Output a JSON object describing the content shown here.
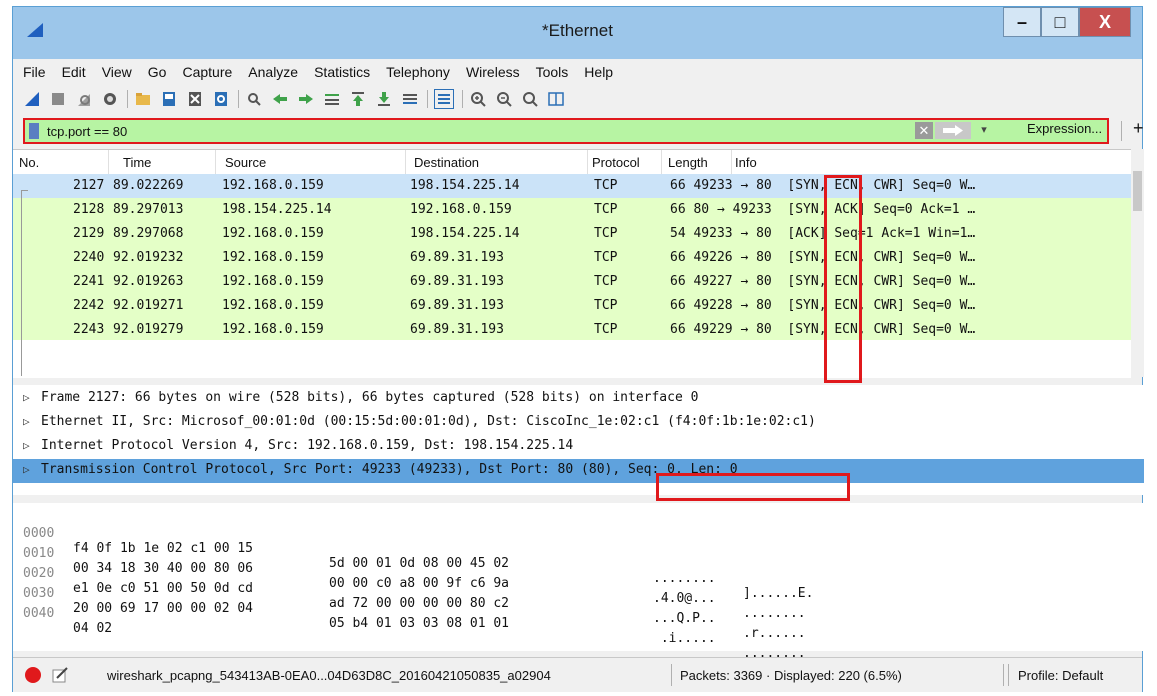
{
  "window": {
    "title": "*Ethernet",
    "min_label": "–",
    "max_label": "□",
    "close_label": "X"
  },
  "menu": [
    "File",
    "Edit",
    "View",
    "Go",
    "Capture",
    "Analyze",
    "Statistics",
    "Telephony",
    "Wireless",
    "Tools",
    "Help"
  ],
  "toolbar_icons": [
    "shark-fin-start",
    "stop",
    "restart",
    "options",
    "open-folder",
    "save",
    "close-file",
    "reload",
    "find",
    "go-back",
    "go-forward",
    "go-to-packet",
    "first-packet",
    "last-packet",
    "autoscroll",
    "colorize",
    "zoom-in",
    "zoom-out",
    "normal-size",
    "resize-columns"
  ],
  "filter": {
    "value": "tcp.port == 80",
    "clear_label": "✕",
    "dropdown_label": "▾",
    "expression_label": "Expression...",
    "plus_label": "+"
  },
  "packet_list": {
    "columns": [
      "No.",
      "Time",
      "Source",
      "Destination",
      "Protocol",
      "Length",
      "Info"
    ],
    "rows": [
      {
        "no": "2127",
        "time": "89.022269",
        "source": "192.168.0.159",
        "destination": "198.154.225.14",
        "protocol": "TCP",
        "info": "66 49233 → 80  [SYN, ECN, CWR] Seq=0 W…"
      },
      {
        "no": "2128",
        "time": "89.297013",
        "source": "198.154.225.14",
        "destination": "192.168.0.159",
        "protocol": "TCP",
        "info": "66 80 → 49233  [SYN, ACK] Seq=0 Ack=1 …"
      },
      {
        "no": "2129",
        "time": "89.297068",
        "source": "192.168.0.159",
        "destination": "198.154.225.14",
        "protocol": "TCP",
        "info": "54 49233 → 80  [ACK] Seq=1 Ack=1 Win=1…"
      },
      {
        "no": "2240",
        "time": "92.019232",
        "source": "192.168.0.159",
        "destination": "69.89.31.193",
        "protocol": "TCP",
        "info": "66 49226 → 80  [SYN, ECN, CWR] Seq=0 W…"
      },
      {
        "no": "2241",
        "time": "92.019263",
        "source": "192.168.0.159",
        "destination": "69.89.31.193",
        "protocol": "TCP",
        "info": "66 49227 → 80  [SYN, ECN, CWR] Seq=0 W…"
      },
      {
        "no": "2242",
        "time": "92.019271",
        "source": "192.168.0.159",
        "destination": "69.89.31.193",
        "protocol": "TCP",
        "info": "66 49228 → 80  [SYN, ECN, CWR] Seq=0 W…"
      },
      {
        "no": "2243",
        "time": "92.019279",
        "source": "192.168.0.159",
        "destination": "69.89.31.193",
        "protocol": "TCP",
        "info": "66 49229 → 80  [SYN, ECN, CWR] Seq=0 W…"
      }
    ]
  },
  "details": [
    {
      "arrow": "▷",
      "text": "Frame 2127: 66 bytes on wire (528 bits), 66 bytes captured (528 bits) on interface 0"
    },
    {
      "arrow": "▷",
      "text": "Ethernet II, Src: Microsof_00:01:0d (00:15:5d:00:01:0d), Dst: CiscoInc_1e:02:c1 (f4:0f:1b:1e:02:c1)"
    },
    {
      "arrow": "▷",
      "text": "Internet Protocol Version 4, Src: 192.168.0.159, Dst: 198.154.225.14"
    },
    {
      "arrow": "▷",
      "text": "Transmission Control Protocol, Src Port: 49233 (49233), Dst Port: 80 (80), Seq: 0, Len: 0"
    }
  ],
  "hex": [
    {
      "offset": "0000",
      "b1": "f4 0f 1b 1e 02 c1 00 15",
      "b2": "5d 00 01 0d 08 00 45 02",
      "a1": "........",
      "a2": "]......E."
    },
    {
      "offset": "0010",
      "b1": "00 34 18 30 40 00 80 06",
      "b2": "00 00 c0 a8 00 9f c6 9a",
      "a1": ".4.0@...",
      "a2": "........"
    },
    {
      "offset": "0020",
      "b1": "e1 0e c0 51 00 50 0d cd",
      "b2": "ad 72 00 00 00 00 80 c2",
      "a1": "...Q.P..",
      "a2": ".r......"
    },
    {
      "offset": "0030",
      "b1": "20 00 69 17 00 00 02 04",
      "b2": "05 b4 01 03 03 08 01 01",
      "a1": " .i.....",
      "a2": "........"
    },
    {
      "offset": "0040",
      "b1": "04 02",
      "b2": "",
      "a1": "..",
      "a2": ""
    }
  ],
  "status": {
    "file": "wireshark_pcapng_543413AB-0EA0...04D63D8C_20160421050835_a02904",
    "packets": "Packets: 3369 · Displayed: 220 (6.5%)",
    "profile": "Profile: Default"
  },
  "colors": {
    "accent": "#e0191c",
    "filter_bg": "#b7f4a3",
    "row_bg": "#e4ffc7",
    "selected_row": "#cbe3f8",
    "selected_detail": "#5fa2dd",
    "titlebar": "#9cc6ea"
  }
}
